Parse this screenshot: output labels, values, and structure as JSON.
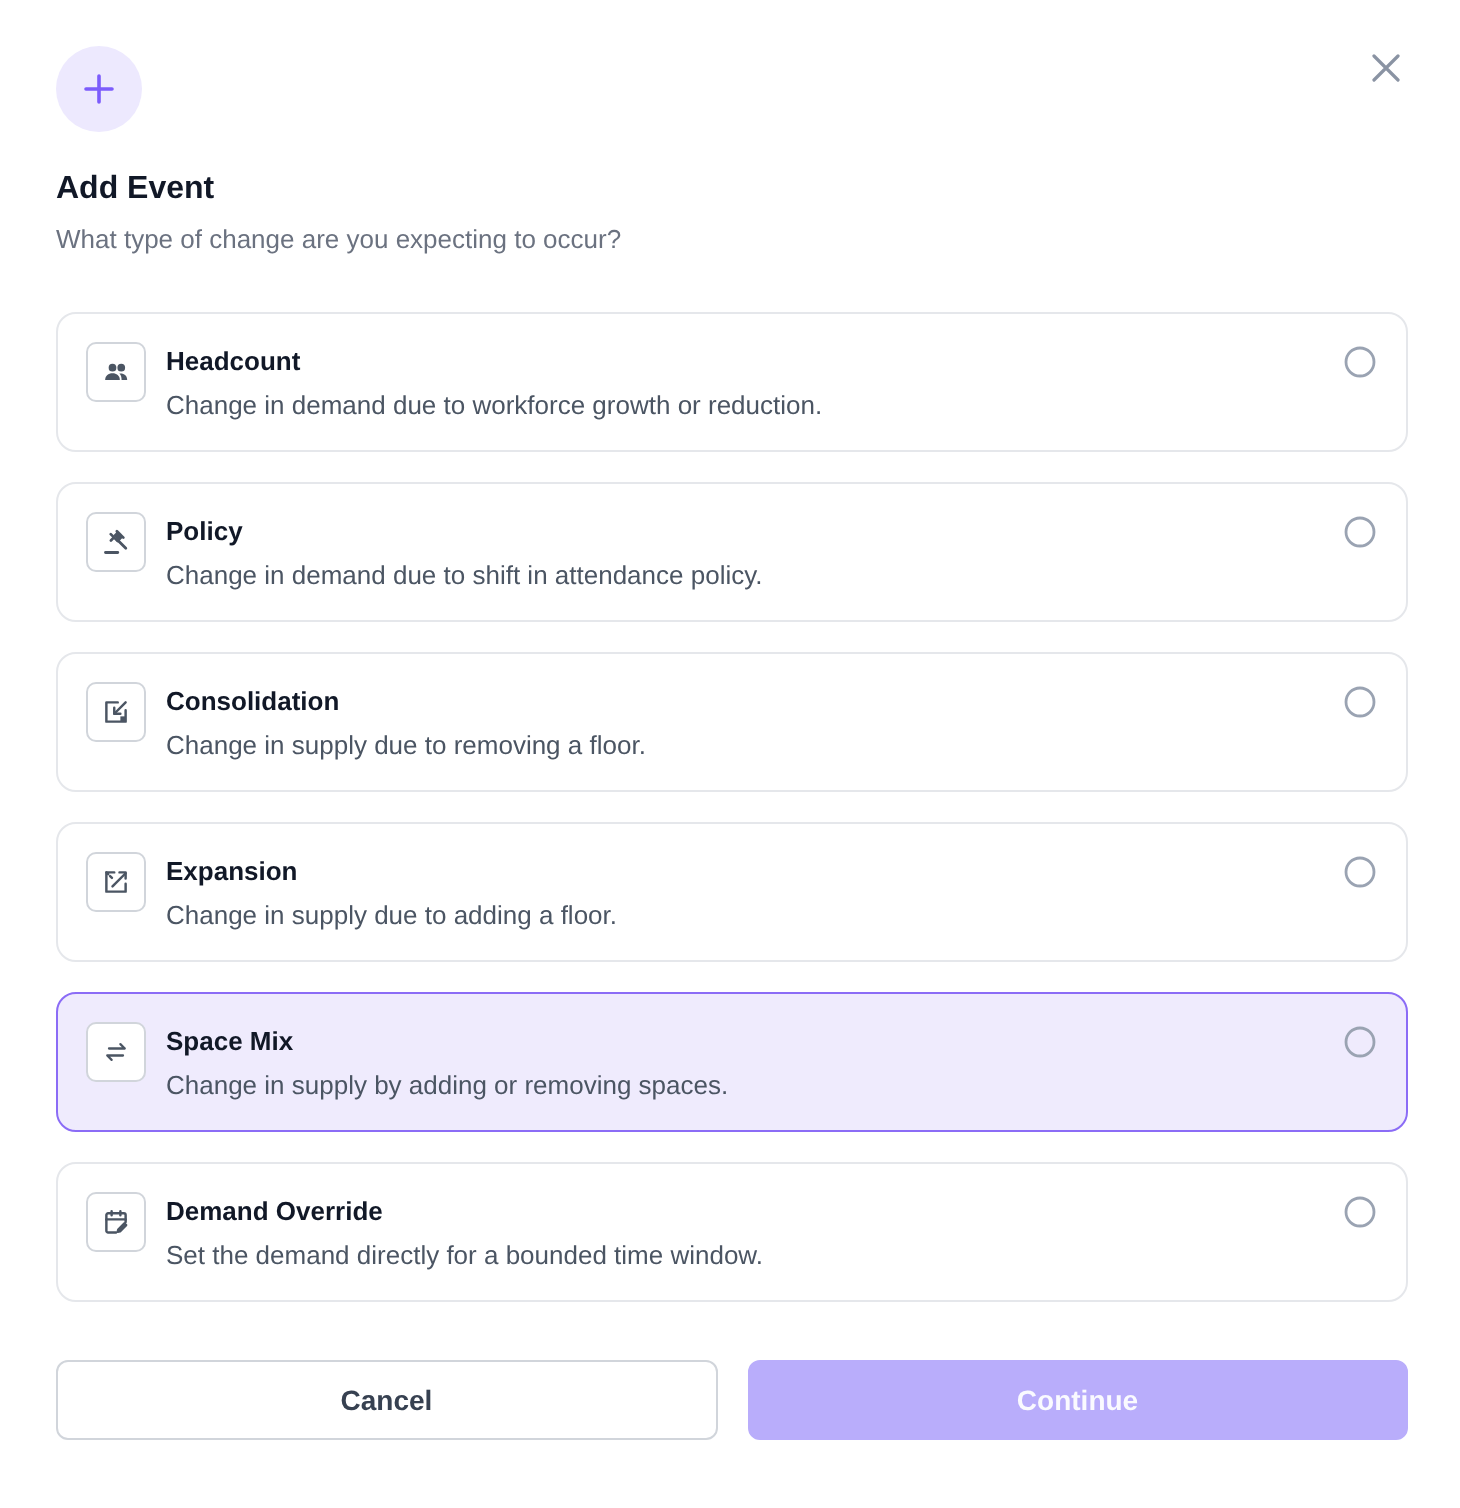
{
  "header": {
    "title": "Add Event",
    "subtitle": "What type of change are you expecting to occur?"
  },
  "options": [
    {
      "kind": "headcount",
      "title": "Headcount",
      "description": "Change in demand due to workforce growth or reduction.",
      "selected": false,
      "highlighted": false
    },
    {
      "kind": "policy",
      "title": "Policy",
      "description": "Change in demand due to shift in attendance policy.",
      "selected": false,
      "highlighted": false
    },
    {
      "kind": "consolidation",
      "title": "Consolidation",
      "description": "Change in supply due to removing a floor.",
      "selected": false,
      "highlighted": false
    },
    {
      "kind": "expansion",
      "title": "Expansion",
      "description": "Change in supply due to adding a floor.",
      "selected": false,
      "highlighted": false
    },
    {
      "kind": "space_mix",
      "title": "Space Mix",
      "description": "Change in supply by adding or removing spaces.",
      "selected": false,
      "highlighted": true
    },
    {
      "kind": "demand_override",
      "title": "Demand Override",
      "description": "Set the demand directly for a bounded time window.",
      "selected": false,
      "highlighted": false
    }
  ],
  "buttons": [
    {
      "kind": "secondary",
      "label": "Cancel",
      "disabled": false
    },
    {
      "kind": "primary",
      "label": "Continue",
      "disabled": true
    }
  ]
}
